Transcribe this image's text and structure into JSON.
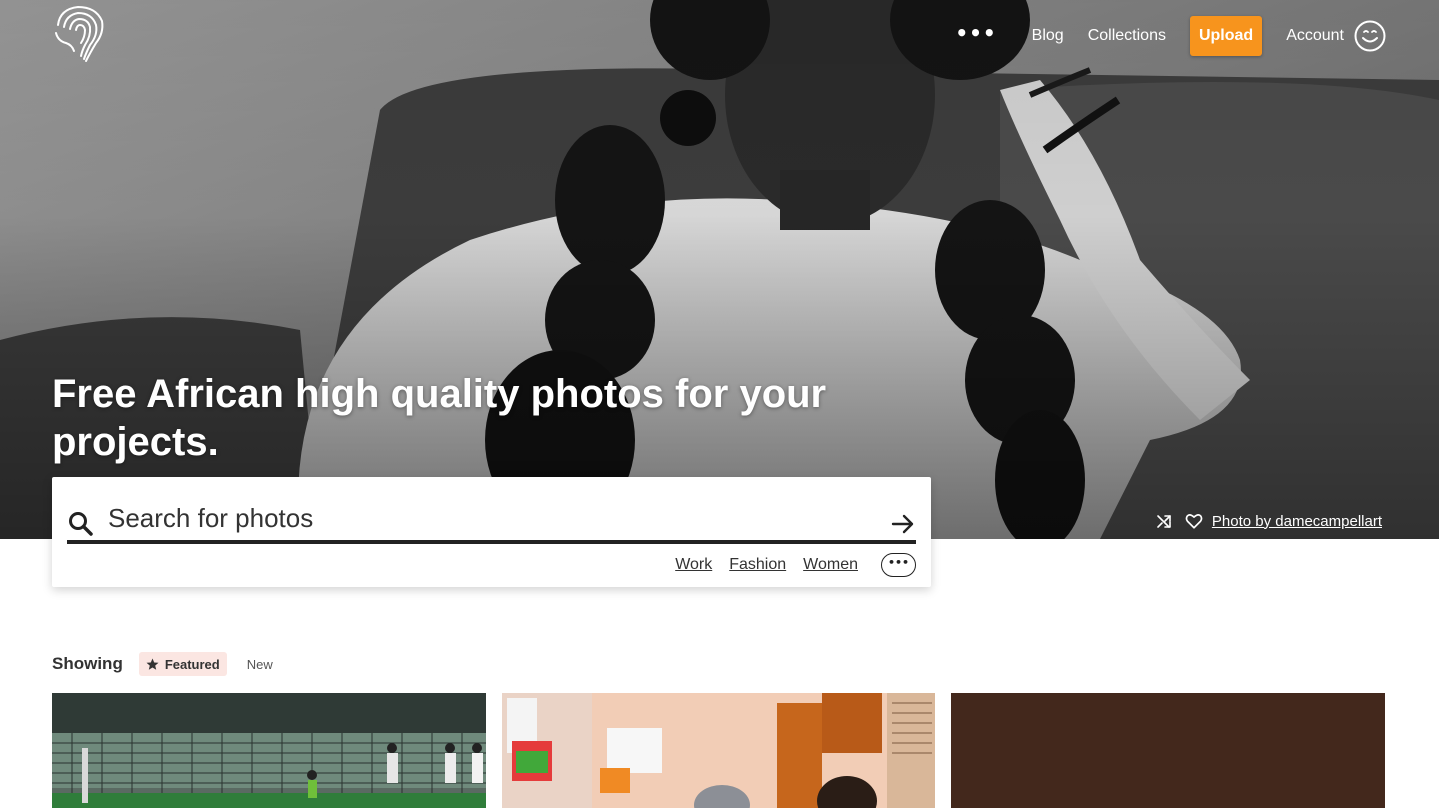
{
  "nav": {
    "more_label": "•••",
    "blog": "Blog",
    "collections": "Collections",
    "upload": "Upload",
    "account": "Account"
  },
  "hero": {
    "title": "Free African high quality photos for your projects.",
    "credit": "Photo by damecampellart"
  },
  "search": {
    "placeholder": "Search for photos",
    "value": "",
    "tags": [
      "Work",
      "Fashion",
      "Women"
    ],
    "more_label": "•••"
  },
  "feed": {
    "showing_label": "Showing",
    "filters": {
      "featured": "Featured",
      "new": "New"
    },
    "photos": [
      "photo-1",
      "photo-2",
      "photo-3"
    ]
  },
  "colors": {
    "accent": "#f7941d",
    "featured_bg": "#fbe6e2"
  },
  "icons": {
    "logo": "fingerprint-africa-logo",
    "account": "smiley-icon",
    "search": "search-icon",
    "submit": "arrow-right-icon",
    "shuffle": "shuffle-icon",
    "like": "heart-icon",
    "featured": "star-icon"
  }
}
